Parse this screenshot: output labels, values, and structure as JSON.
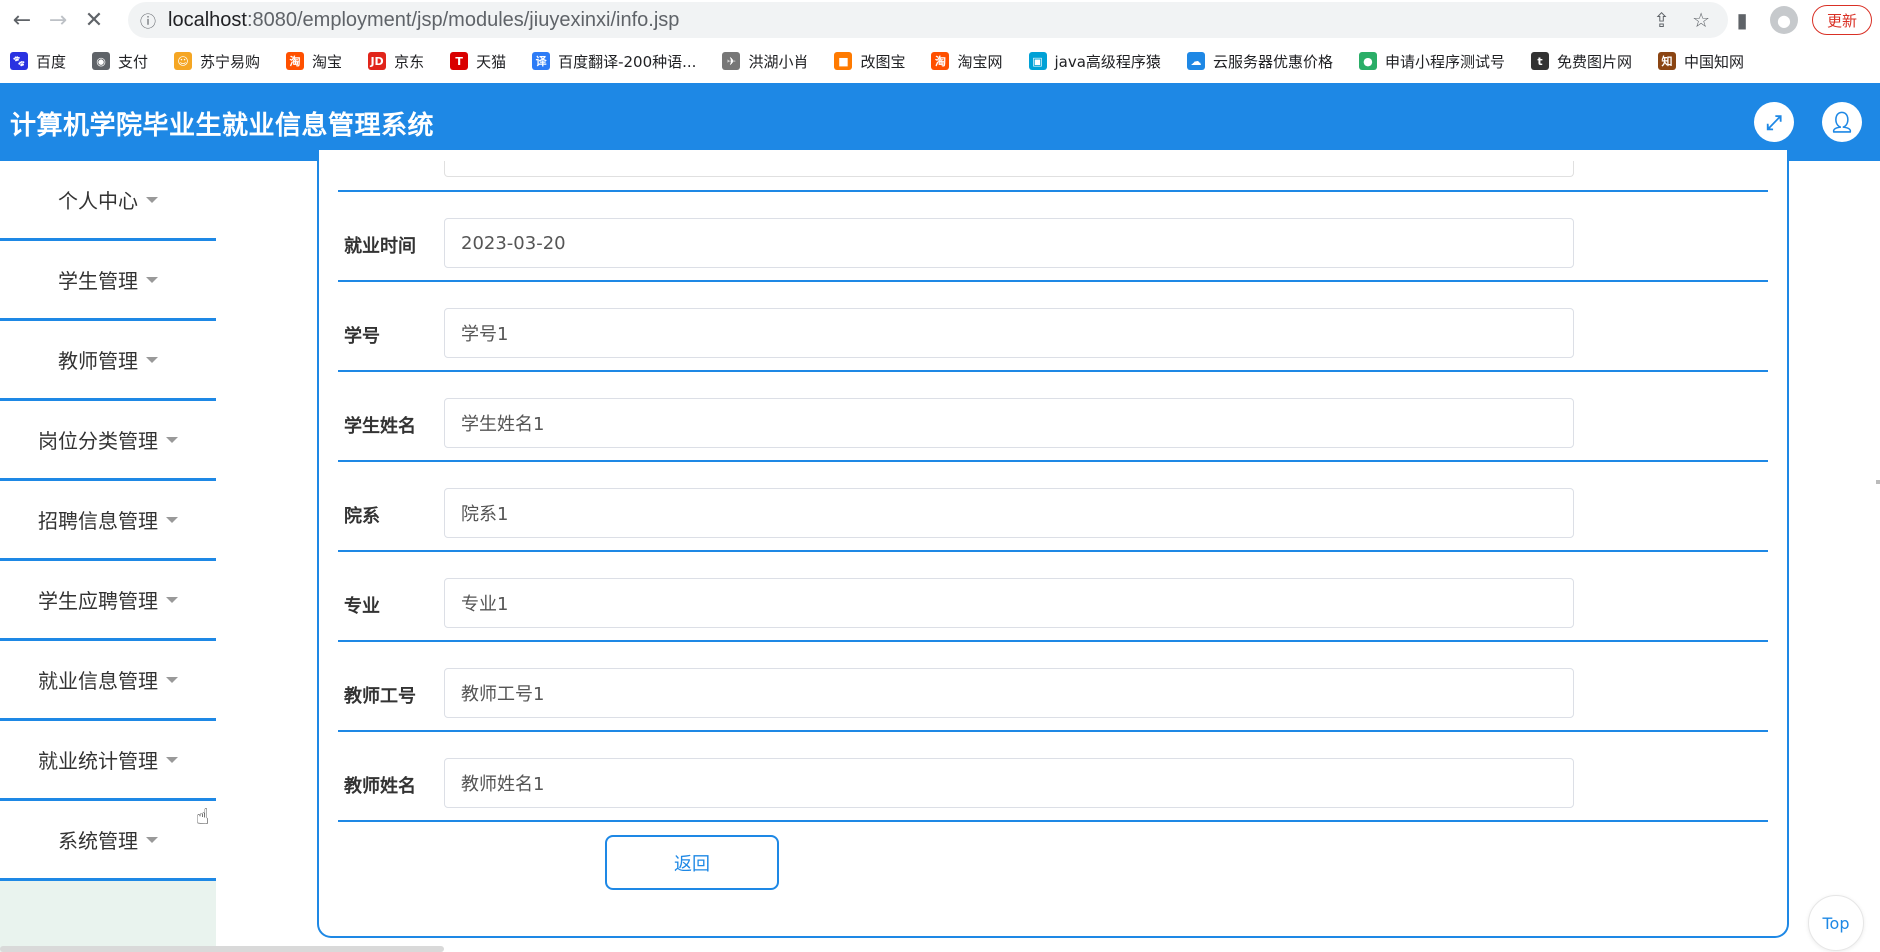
{
  "browser": {
    "url_host": "localhost",
    "url_rest": ":8080/employment/jsp/modules/jiuyexinxi/info.jsp",
    "update_label": "更新"
  },
  "bookmarks": [
    {
      "label": "百度",
      "icon": "baidu-paw-icon",
      "color": "#2932e1"
    },
    {
      "label": "支付",
      "icon": "globe-icon",
      "color": "#5f6368"
    },
    {
      "label": "苏宁易购",
      "icon": "suning-lion-icon",
      "color": "#f5a623"
    },
    {
      "label": "淘宝",
      "icon": "taobao-icon",
      "color": "#ff5000"
    },
    {
      "label": "京东",
      "icon": "jd-icon",
      "color": "#e1251b"
    },
    {
      "label": "天猫",
      "icon": "tmall-icon",
      "color": "#d90000"
    },
    {
      "label": "百度翻译-200种语...",
      "icon": "translate-icon",
      "color": "#2d7cf6"
    },
    {
      "label": "洪湖小肖",
      "icon": "bird-icon",
      "color": "#777777"
    },
    {
      "label": "改图宝",
      "icon": "gaitubao-icon",
      "color": "#ff7a00"
    },
    {
      "label": "淘宝网",
      "icon": "taobao-icon",
      "color": "#ff5000"
    },
    {
      "label": "java高级程序猿",
      "icon": "bilibili-icon",
      "color": "#00a1d6"
    },
    {
      "label": "云服务器优惠价格",
      "icon": "cloud-icon",
      "color": "#1e88e5"
    },
    {
      "label": "申请小程序测试号",
      "icon": "wechat-icon",
      "color": "#2aae67"
    },
    {
      "label": "免费图片网",
      "icon": "t-circle-icon",
      "color": "#333333"
    },
    {
      "label": "中国知网",
      "icon": "cnki-icon",
      "color": "#8b4513"
    }
  ],
  "header": {
    "title": "计算机学院毕业生就业信息管理系统"
  },
  "sidebar": {
    "items": [
      {
        "label": "个人中心"
      },
      {
        "label": "学生管理"
      },
      {
        "label": "教师管理"
      },
      {
        "label": "岗位分类管理"
      },
      {
        "label": "招聘信息管理"
      },
      {
        "label": "学生应聘管理"
      },
      {
        "label": "就业信息管理"
      },
      {
        "label": "就业统计管理"
      },
      {
        "label": "系统管理"
      }
    ]
  },
  "form": {
    "fields": [
      {
        "label": "就业时间",
        "value": "2023-03-20"
      },
      {
        "label": "学号",
        "value": "学号1"
      },
      {
        "label": "学生姓名",
        "value": "学生姓名1"
      },
      {
        "label": "院系",
        "value": "院系1"
      },
      {
        "label": "专业",
        "value": "专业1"
      },
      {
        "label": "教师工号",
        "value": "教师工号1"
      },
      {
        "label": "教师姓名",
        "value": "教师姓名1"
      }
    ],
    "back_label": "返回"
  },
  "top_button": "Top"
}
